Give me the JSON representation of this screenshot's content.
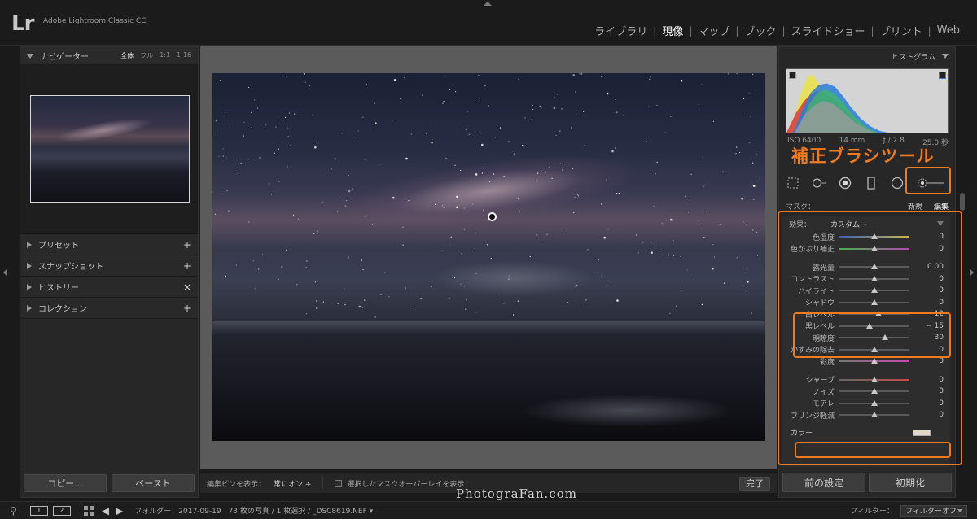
{
  "app": {
    "logo": "Lr",
    "title": "Adobe Lightroom Classic CC"
  },
  "modules": [
    {
      "label": "ライブラリ",
      "active": false
    },
    {
      "label": "現像",
      "active": true
    },
    {
      "label": "マップ",
      "active": false
    },
    {
      "label": "ブック",
      "active": false
    },
    {
      "label": "スライドショー",
      "active": false
    },
    {
      "label": "プリント",
      "active": false
    },
    {
      "label": "Web",
      "active": false
    }
  ],
  "left_panel": {
    "navigator": {
      "title": "ナビゲーター",
      "zoom": [
        "全体",
        "フル",
        "1:1",
        "1:16"
      ],
      "zoom_active": "全体"
    },
    "sections": [
      {
        "label": "プリセット",
        "action": "+"
      },
      {
        "label": "スナップショット",
        "action": "+"
      },
      {
        "label": "ヒストリー",
        "action": "×"
      },
      {
        "label": "コレクション",
        "action": "+"
      }
    ],
    "copy_label": "コピー...",
    "paste_label": "ペースト"
  },
  "toolbar": {
    "show_pins_label": "編集ピンを表示：",
    "show_pins_value": "常にオン ÷",
    "overlay_label": "選択したマスクオーバーレイを表示",
    "done_label": "完了"
  },
  "right_panel": {
    "histogram_title": "ヒストグラム",
    "exif": {
      "iso": "ISO 6400",
      "focal": "14 mm",
      "aperture": "ƒ / 2.8",
      "shutter": "25.0 秒"
    },
    "callout": "補正ブラシツール",
    "mask_label": "マスク：",
    "mask_new": "新規",
    "mask_edit": "編集",
    "effect_label": "効果：",
    "effect_value": "カスタム ÷",
    "slider_groups": [
      [
        {
          "label": "色温度",
          "value": "0",
          "pos": 0.5,
          "track": "temp"
        },
        {
          "label": "色かぶり補正",
          "value": "0",
          "pos": 0.5,
          "track": "tint"
        }
      ],
      [
        {
          "label": "露光量",
          "value": "0.00",
          "pos": 0.5,
          "track": "gray"
        },
        {
          "label": "コントラスト",
          "value": "0",
          "pos": 0.5,
          "track": "gray"
        },
        {
          "label": "ハイライト",
          "value": "0",
          "pos": 0.5,
          "track": "gray"
        },
        {
          "label": "シャドウ",
          "value": "0",
          "pos": 0.5,
          "track": "gray"
        },
        {
          "label": "白レベル",
          "value": "12",
          "pos": 0.56,
          "track": "gray"
        },
        {
          "label": "黒レベル",
          "value": "− 15",
          "pos": 0.43,
          "track": "gray"
        },
        {
          "label": "明瞭度",
          "value": "30",
          "pos": 0.65,
          "track": "gray"
        },
        {
          "label": "かすみの除去",
          "value": "0",
          "pos": 0.5,
          "track": "gray"
        },
        {
          "label": "彩度",
          "value": "0",
          "pos": 0.5,
          "track": "sat"
        }
      ],
      [
        {
          "label": "シャープ",
          "value": "0",
          "pos": 0.5,
          "track": "red"
        },
        {
          "label": "ノイズ",
          "value": "0",
          "pos": 0.5,
          "track": "gray"
        },
        {
          "label": "モアレ",
          "value": "0",
          "pos": 0.5,
          "track": "gray"
        },
        {
          "label": "フリンジ軽減",
          "value": "0",
          "pos": 0.5,
          "track": "gray"
        }
      ]
    ],
    "color_label": "カラー",
    "prev_label": "前の設定",
    "reset_label": "初期化"
  },
  "filmstrip": {
    "monitor1": "1",
    "monitor2": "2",
    "folder_text": "フォルダー：2017-09-19　73 枚の写真 / 1 枚選択 / _DSC8619.NEF ▾",
    "filter_label": "フィルター：",
    "filter_value": "フィルターオフ"
  },
  "watermark": "PhotograFan.com",
  "colors": {
    "accent": "#f07a1c"
  }
}
